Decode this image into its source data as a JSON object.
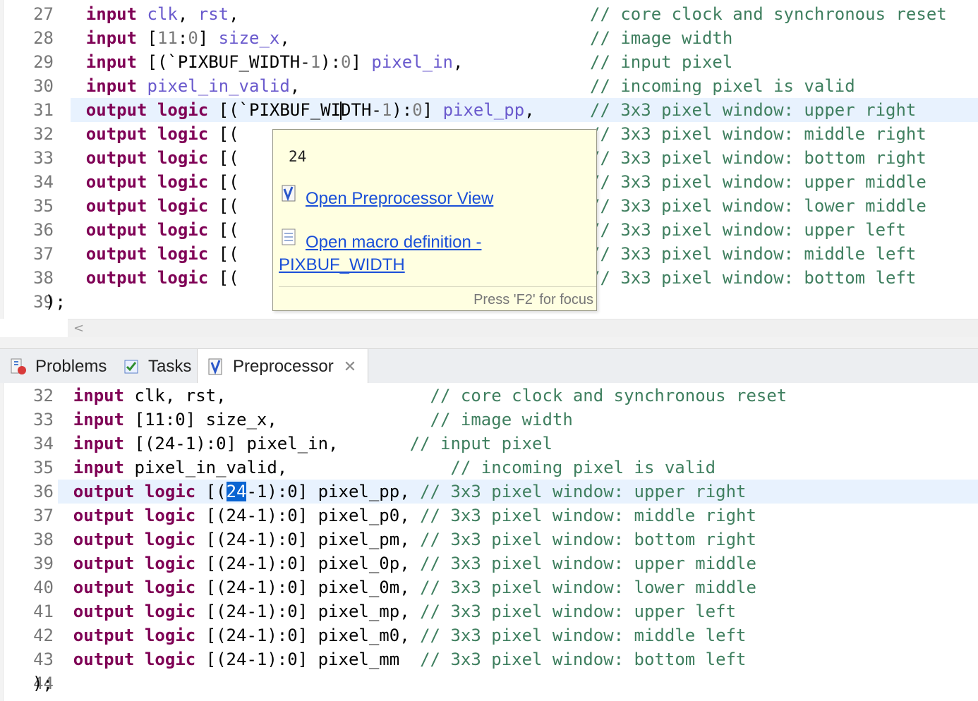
{
  "editor": {
    "lines": [
      {
        "n": "27",
        "indent": "    ",
        "parts": [
          [
            "kw",
            "input"
          ],
          [
            "t",
            " "
          ],
          [
            "id",
            "clk"
          ],
          [
            "t",
            ", "
          ],
          [
            "id",
            "rst"
          ],
          [
            "t",
            ","
          ]
        ],
        "comment": "// core clock and synchronous reset"
      },
      {
        "n": "28",
        "indent": "    ",
        "parts": [
          [
            "kw",
            "input"
          ],
          [
            "t",
            " ["
          ],
          [
            "num",
            "11"
          ],
          [
            "t",
            ":"
          ],
          [
            "num",
            "0"
          ],
          [
            "t",
            "] "
          ],
          [
            "id",
            "size_x"
          ],
          [
            "t",
            ","
          ]
        ],
        "comment": "// image width"
      },
      {
        "n": "29",
        "indent": "    ",
        "parts": [
          [
            "kw",
            "input"
          ],
          [
            "t",
            " [(`PIXBUF_WIDTH-"
          ],
          [
            "num",
            "1"
          ],
          [
            "t",
            "):"
          ],
          [
            "num",
            "0"
          ],
          [
            "t",
            "] "
          ],
          [
            "id",
            "pixel_in"
          ],
          [
            "t",
            ","
          ]
        ],
        "comment": "// input pixel"
      },
      {
        "n": "30",
        "indent": "    ",
        "parts": [
          [
            "kw",
            "input"
          ],
          [
            "t",
            " "
          ],
          [
            "id",
            "pixel_in_valid"
          ],
          [
            "t",
            ","
          ]
        ],
        "comment": "// incoming pixel is valid"
      },
      {
        "n": "31",
        "indent": "    ",
        "parts": [
          [
            "kw",
            "output"
          ],
          [
            "t",
            " "
          ],
          [
            "kw",
            "logic"
          ],
          [
            "t",
            " [(`PIXBUF_WI"
          ],
          [
            "caret",
            ""
          ],
          [
            "t",
            "DTH-"
          ],
          [
            "num",
            "1"
          ],
          [
            "t",
            "):"
          ],
          [
            "num",
            "0"
          ],
          [
            "t",
            "] "
          ],
          [
            "id",
            "pixel_pp"
          ],
          [
            "t",
            ", "
          ]
        ],
        "comment": "// 3x3 pixel window: upper right",
        "current": true
      },
      {
        "n": "32",
        "indent": "    ",
        "parts": [
          [
            "kw",
            "output"
          ],
          [
            "t",
            " "
          ],
          [
            "kw",
            "logic"
          ],
          [
            "t",
            " [("
          ]
        ],
        "comment": "// 3x3 pixel window: middle right"
      },
      {
        "n": "33",
        "indent": "    ",
        "parts": [
          [
            "kw",
            "output"
          ],
          [
            "t",
            " "
          ],
          [
            "kw",
            "logic"
          ],
          [
            "t",
            " [("
          ]
        ],
        "comment": "// 3x3 pixel window: bottom right"
      },
      {
        "n": "34",
        "indent": "    ",
        "parts": [
          [
            "kw",
            "output"
          ],
          [
            "t",
            " "
          ],
          [
            "kw",
            "logic"
          ],
          [
            "t",
            " [("
          ]
        ],
        "comment": "// 3x3 pixel window: upper middle"
      },
      {
        "n": "35",
        "indent": "    ",
        "parts": [
          [
            "kw",
            "output"
          ],
          [
            "t",
            " "
          ],
          [
            "kw",
            "logic"
          ],
          [
            "t",
            " [("
          ]
        ],
        "comment": "// 3x3 pixel window: lower middle"
      },
      {
        "n": "36",
        "indent": "    ",
        "parts": [
          [
            "kw",
            "output"
          ],
          [
            "t",
            " "
          ],
          [
            "kw",
            "logic"
          ],
          [
            "t",
            " [("
          ]
        ],
        "comment": "// 3x3 pixel window: upper left"
      },
      {
        "n": "37",
        "indent": "    ",
        "parts": [
          [
            "kw",
            "output"
          ],
          [
            "t",
            " "
          ],
          [
            "kw",
            "logic"
          ],
          [
            "t",
            " [("
          ]
        ],
        "comment": "// 3x3 pixel window: middle left"
      },
      {
        "n": "38",
        "indent": "    ",
        "parts": [
          [
            "kw",
            "output"
          ],
          [
            "t",
            " "
          ],
          [
            "kw",
            "logic"
          ],
          [
            "t",
            " [("
          ]
        ],
        "comment": "// 3x3 pixel window: bottom left"
      },
      {
        "n": "39",
        "indent": "",
        "parts": [
          [
            "t",
            ");"
          ]
        ],
        "comment": ""
      }
    ]
  },
  "hover": {
    "value": "24",
    "link1": "Open Preprocessor View",
    "link2_line1": "Open macro definition -",
    "link2_line2": "PIXBUF_WIDTH",
    "status": "Press 'F2' for focus"
  },
  "tabs": {
    "problems": "Problems",
    "tasks": "Tasks",
    "preprocessor": "Preprocessor",
    "close": "✕"
  },
  "scroll": {
    "left_arrow": "<"
  },
  "preprocessor": {
    "lines": [
      {
        "n": "32",
        "indent": "    ",
        "parts": [
          [
            "kw",
            "input"
          ],
          [
            "t",
            " clk, rst,"
          ]
        ],
        "pad": "                    ",
        "comment": "// core clock and synchronous reset"
      },
      {
        "n": "33",
        "indent": "    ",
        "parts": [
          [
            "kw",
            "input"
          ],
          [
            "t",
            " [11:0] size_x,"
          ]
        ],
        "pad": "               ",
        "comment": "// image width"
      },
      {
        "n": "34",
        "indent": "    ",
        "parts": [
          [
            "kw",
            "input"
          ],
          [
            "t",
            " [(24-1):0] pixel_in,"
          ]
        ],
        "pad": "       ",
        "comment": "// input pixel"
      },
      {
        "n": "35",
        "indent": "    ",
        "parts": [
          [
            "kw",
            "input"
          ],
          [
            "t",
            " pixel_in_valid,"
          ]
        ],
        "pad": "                ",
        "comment": "// incoming pixel is valid"
      },
      {
        "n": "36",
        "indent": "    ",
        "parts": [
          [
            "kw",
            "output"
          ],
          [
            "t",
            " "
          ],
          [
            "kw",
            "logic"
          ],
          [
            "t",
            " [("
          ],
          [
            "sel",
            "24"
          ],
          [
            "t",
            "-1):0] pixel_pp, "
          ]
        ],
        "pad": "",
        "comment": "// 3x3 pixel window: upper right",
        "current": true
      },
      {
        "n": "37",
        "indent": "    ",
        "parts": [
          [
            "kw",
            "output"
          ],
          [
            "t",
            " "
          ],
          [
            "kw",
            "logic"
          ],
          [
            "t",
            " [(24-1):0] pixel_p0, "
          ]
        ],
        "pad": "",
        "comment": "// 3x3 pixel window: middle right"
      },
      {
        "n": "38",
        "indent": "    ",
        "parts": [
          [
            "kw",
            "output"
          ],
          [
            "t",
            " "
          ],
          [
            "kw",
            "logic"
          ],
          [
            "t",
            " [(24-1):0] pixel_pm, "
          ]
        ],
        "pad": "",
        "comment": "// 3x3 pixel window: bottom right"
      },
      {
        "n": "39",
        "indent": "    ",
        "parts": [
          [
            "kw",
            "output"
          ],
          [
            "t",
            " "
          ],
          [
            "kw",
            "logic"
          ],
          [
            "t",
            " [(24-1):0] pixel_0p, "
          ]
        ],
        "pad": "",
        "comment": "// 3x3 pixel window: upper middle"
      },
      {
        "n": "40",
        "indent": "    ",
        "parts": [
          [
            "kw",
            "output"
          ],
          [
            "t",
            " "
          ],
          [
            "kw",
            "logic"
          ],
          [
            "t",
            " [(24-1):0] pixel_0m, "
          ]
        ],
        "pad": "",
        "comment": "// 3x3 pixel window: lower middle"
      },
      {
        "n": "41",
        "indent": "    ",
        "parts": [
          [
            "kw",
            "output"
          ],
          [
            "t",
            " "
          ],
          [
            "kw",
            "logic"
          ],
          [
            "t",
            " [(24-1):0] pixel_mp, "
          ]
        ],
        "pad": "",
        "comment": "// 3x3 pixel window: upper left"
      },
      {
        "n": "42",
        "indent": "    ",
        "parts": [
          [
            "kw",
            "output"
          ],
          [
            "t",
            " "
          ],
          [
            "kw",
            "logic"
          ],
          [
            "t",
            " [(24-1):0] pixel_m0, "
          ]
        ],
        "pad": "",
        "comment": "// 3x3 pixel window: middle left"
      },
      {
        "n": "43",
        "indent": "    ",
        "parts": [
          [
            "kw",
            "output"
          ],
          [
            "t",
            " "
          ],
          [
            "kw",
            "logic"
          ],
          [
            "t",
            " [(24-1):0] pixel_mm  "
          ]
        ],
        "pad": "",
        "comment": "// 3x3 pixel window: bottom left"
      },
      {
        "n": "44",
        "indent": "",
        "parts": [
          [
            "t",
            ");"
          ]
        ],
        "pad": "",
        "comment": ""
      }
    ]
  },
  "colors": {
    "keyword": "#7f0055",
    "identifier": "#6a5acd",
    "comment": "#3f7f5f",
    "current_line": "#e8f2fe",
    "hover_bg": "#ffffe1",
    "link": "#1a4fd8",
    "selection": "#0a64d2"
  }
}
